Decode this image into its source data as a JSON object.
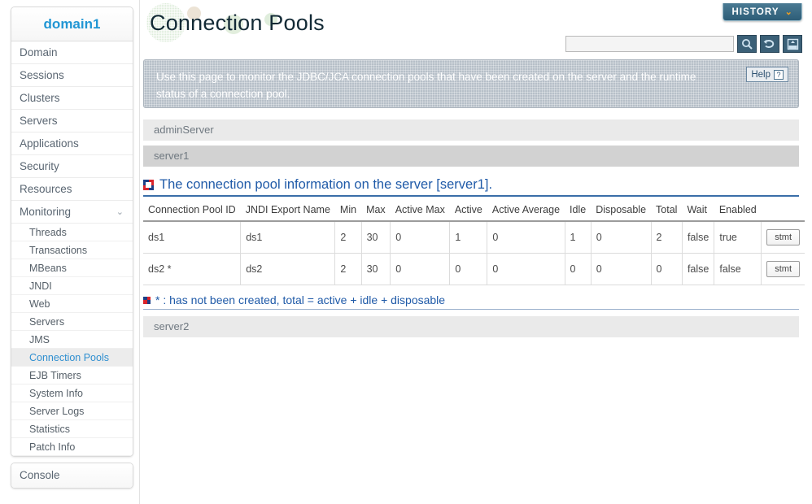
{
  "sidebar": {
    "brand": "domain1",
    "items": [
      {
        "label": "Domain"
      },
      {
        "label": "Sessions"
      },
      {
        "label": "Clusters"
      },
      {
        "label": "Servers"
      },
      {
        "label": "Applications"
      },
      {
        "label": "Security"
      },
      {
        "label": "Resources"
      },
      {
        "label": "Monitoring",
        "expanded": true,
        "chevron": "chevron-down-icon",
        "chevron_glyph": "⌄"
      }
    ],
    "sub_items": [
      {
        "label": "Threads",
        "active": false
      },
      {
        "label": "Transactions",
        "active": false
      },
      {
        "label": "MBeans",
        "active": false
      },
      {
        "label": "JNDI",
        "active": false
      },
      {
        "label": "Web",
        "active": false
      },
      {
        "label": "Servers",
        "active": false
      },
      {
        "label": "JMS",
        "active": false
      },
      {
        "label": "Connection Pools",
        "active": true
      },
      {
        "label": "EJB Timers",
        "active": false
      },
      {
        "label": "System Info",
        "active": false
      },
      {
        "label": "Server Logs",
        "active": false
      },
      {
        "label": "Statistics",
        "active": false
      },
      {
        "label": "Patch Info",
        "active": false
      }
    ],
    "console_label": "Console",
    "brand_color": "#2196d4",
    "active_color": "#2f8fd0"
  },
  "header": {
    "page_title": "Connection Pools",
    "history_label": "HISTORY",
    "history_chevron_glyph": "⌄",
    "history_chevron_color": "#f0a020",
    "history_bg": "#2d5d77"
  },
  "search": {
    "value": "",
    "placeholder": "",
    "buttons": [
      {
        "name": "search-icon",
        "title": "Search"
      },
      {
        "name": "refresh-icon",
        "title": "Refresh"
      },
      {
        "name": "xml-export-icon",
        "title": "XML",
        "label": "XML"
      }
    ]
  },
  "banner": {
    "text": "Use this page to monitor the JDBC/JCA connection pools that have been created on the server and the runtime status of a connection pool.",
    "help_label": "Help",
    "help_glyph": "?",
    "bg": "#b6bfc8"
  },
  "servers": [
    {
      "name": "adminServer",
      "state": "light",
      "position": "above"
    },
    {
      "name": "server1",
      "state": "dark",
      "position": "selected"
    },
    {
      "name": "server2",
      "state": "light",
      "position": "below"
    }
  ],
  "section": {
    "heading": "The connection pool information on the server [server1].",
    "heading_color": "#1f5aa8",
    "icon": "square-marker-icon"
  },
  "table": {
    "columns": [
      "Connection Pool ID",
      "JNDI Export Name",
      "Min",
      "Max",
      "Active Max",
      "Active",
      "Active Average",
      "Idle",
      "Disposable",
      "Total",
      "Wait",
      "Enabled"
    ],
    "rows": [
      {
        "cells": [
          "ds1",
          "ds1",
          "2",
          "30",
          "0",
          "1",
          "0",
          "1",
          "0",
          "2",
          "false",
          "true"
        ],
        "action_label": "stmt"
      },
      {
        "cells": [
          "ds2 *",
          "ds2",
          "2",
          "30",
          "0",
          "0",
          "0",
          "0",
          "0",
          "0",
          "false",
          "false"
        ],
        "action_label": "stmt"
      }
    ]
  },
  "footnote": {
    "text": "* : has not been created, total = active + idle + disposable",
    "color": "#1f5aa8"
  }
}
